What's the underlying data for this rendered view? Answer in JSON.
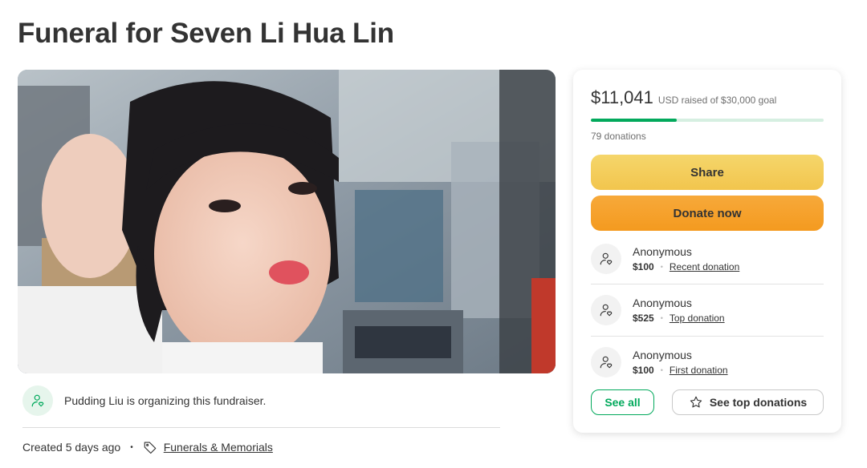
{
  "page": {
    "title": "Funeral for Seven Li Hua Lin"
  },
  "organizer": {
    "text": "Pudding Liu is organizing this fundraiser."
  },
  "meta": {
    "created": "Created 5 days ago",
    "separator": "•",
    "category": "Funerals & Memorials"
  },
  "donation_card": {
    "raised_amount": "$11,041",
    "raised_detail": "USD raised of $30,000 goal",
    "progress_fraction": 0.368,
    "donation_count": "79 donations",
    "share_label": "Share",
    "donate_label": "Donate now",
    "donors": [
      {
        "name": "Anonymous",
        "amount": "$100",
        "type": "Recent donation"
      },
      {
        "name": "Anonymous",
        "amount": "$525",
        "type": "Top donation"
      },
      {
        "name": "Anonymous",
        "amount": "$100",
        "type": "First donation"
      }
    ],
    "see_all_label": "See all",
    "see_top_label": "See top donations",
    "donor_separator": "•"
  },
  "icons": {
    "organizer": "person-heart-icon",
    "tag": "tag-icon",
    "donor": "person-heart-icon",
    "star": "star-icon"
  },
  "colors": {
    "accent_green": "#02a95c",
    "progress_track": "#d6efe1",
    "share_yellow": "#f2c54d",
    "donate_orange": "#f49a1f",
    "text": "#333333"
  }
}
